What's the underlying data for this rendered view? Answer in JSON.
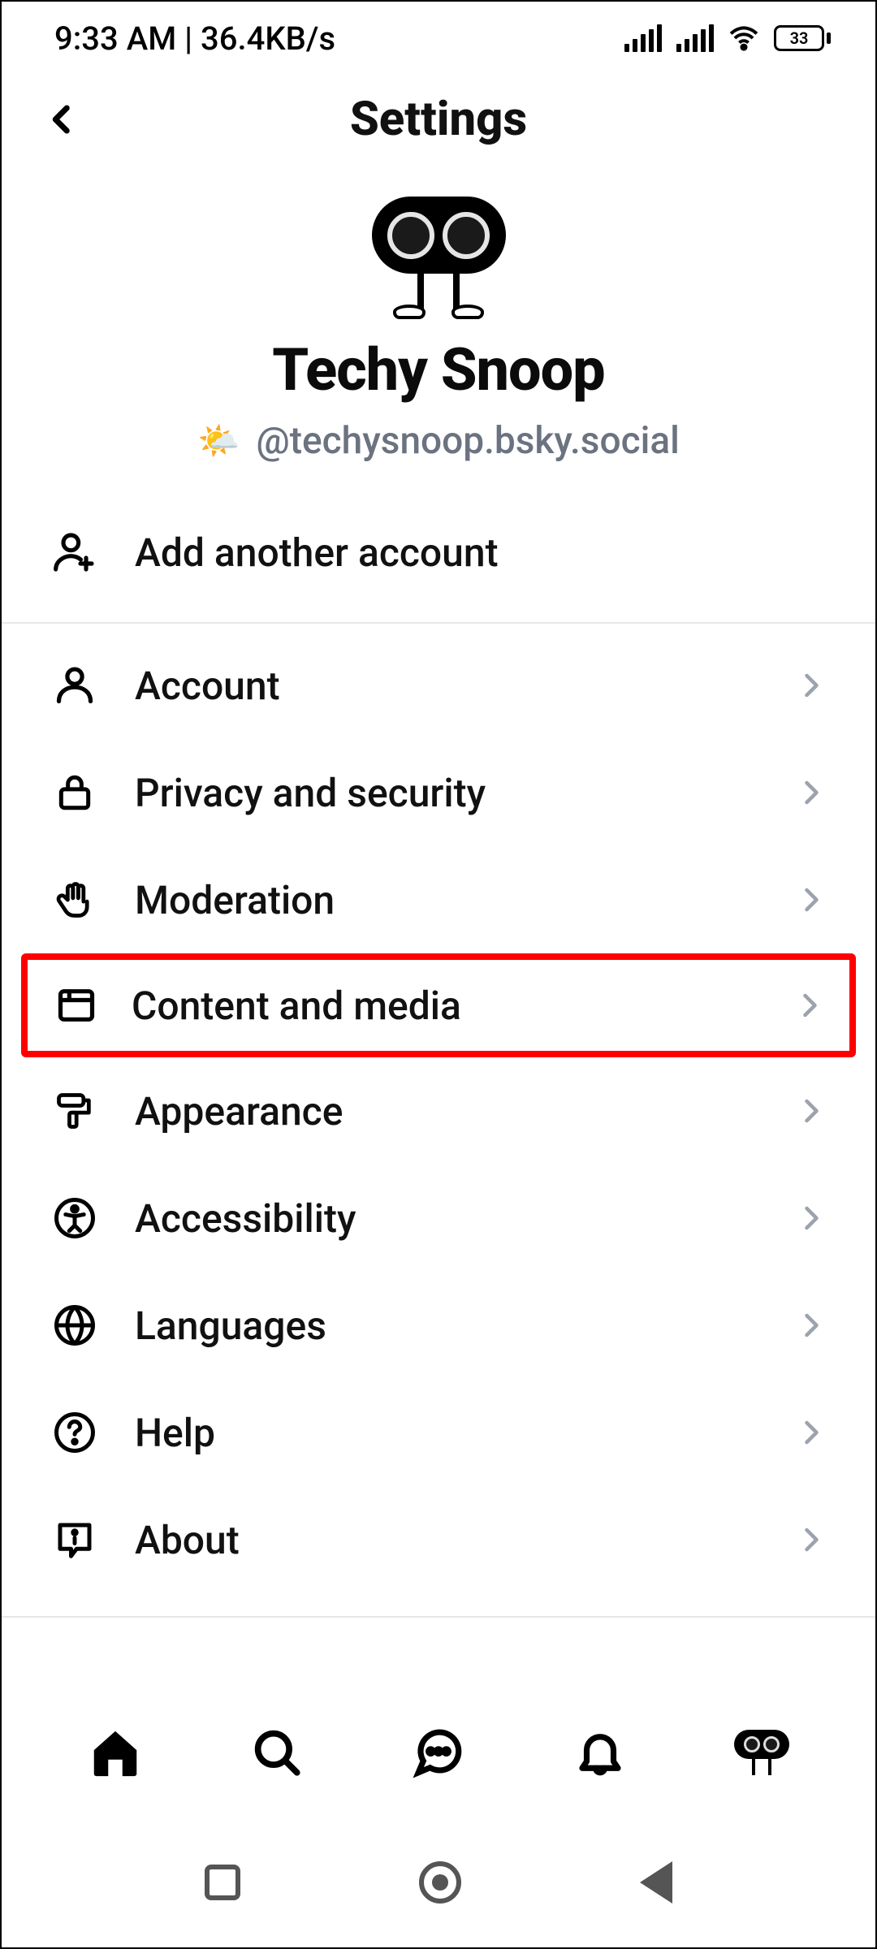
{
  "status": {
    "time": "9:33 AM",
    "net_speed": "36.4KB/s",
    "battery_pct": "33"
  },
  "header": {
    "title": "Settings"
  },
  "profile": {
    "name": "Techy Snoop",
    "handle": "@techysnoop.bsky.social"
  },
  "add_account_label": "Add another account",
  "menu": {
    "account": "Account",
    "privacy": "Privacy and security",
    "moderation": "Moderation",
    "content": "Content and media",
    "appearance": "Appearance",
    "accessibility": "Accessibility",
    "languages": "Languages",
    "help": "Help",
    "about": "About"
  },
  "highlighted_key": "content"
}
